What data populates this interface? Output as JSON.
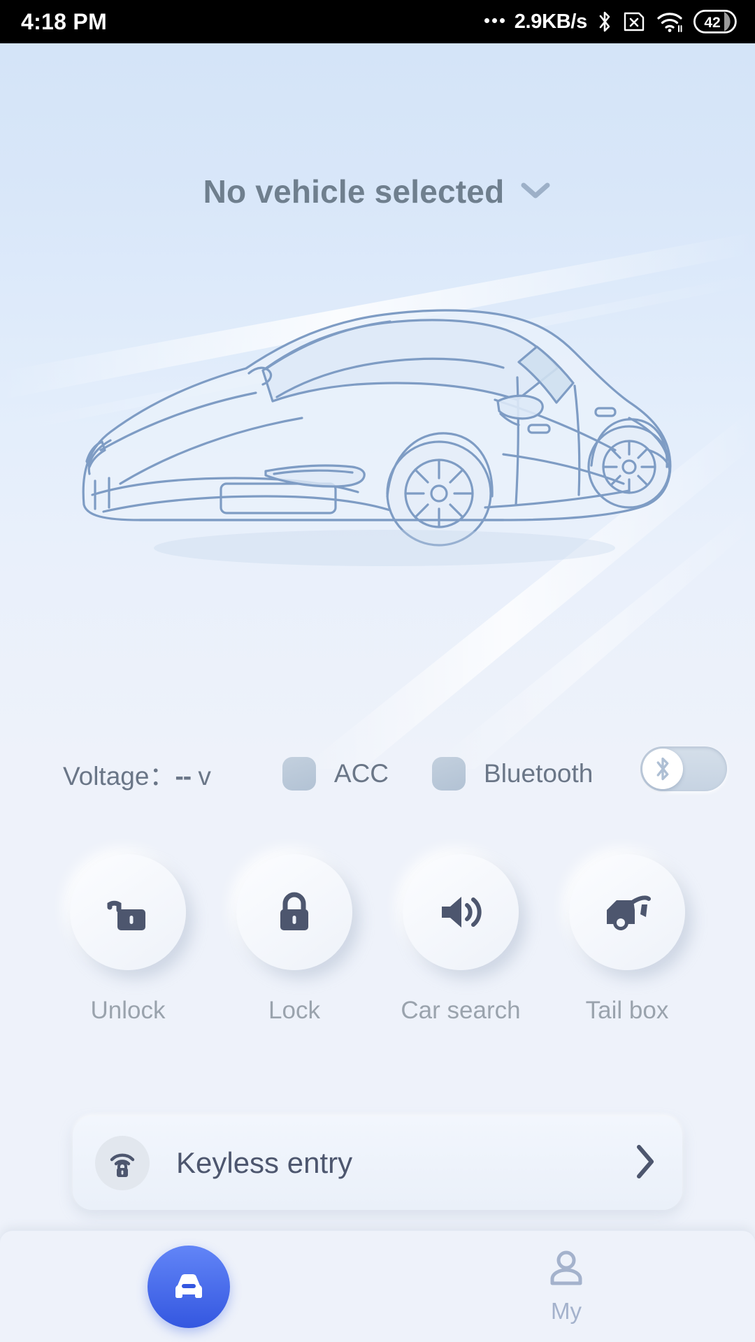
{
  "status_bar": {
    "time": "4:18 PM",
    "data_rate": "2.9KB/s",
    "battery_level": "42",
    "icons": [
      "bluetooth-icon",
      "sim-disabled-icon",
      "wifi-icon",
      "battery-icon"
    ]
  },
  "header": {
    "title": "No vehicle selected",
    "dropdown_icon": "chevron-down-icon",
    "illustration": "car-line-art-illustration"
  },
  "vehicle_status": {
    "voltage_label": "Voltage：",
    "voltage_value": "--",
    "voltage_unit": "v",
    "acc_label": "ACC",
    "bluetooth_label": "Bluetooth",
    "bluetooth_toggle_state": "off",
    "bluetooth_toggle_icon": "bluetooth-icon"
  },
  "actions": [
    {
      "label": "Unlock",
      "icon": "unlock-icon"
    },
    {
      "label": "Lock",
      "icon": "lock-icon"
    },
    {
      "label": "Car search",
      "icon": "speaker-volume-icon"
    },
    {
      "label": "Tail box",
      "icon": "car-trunk-open-icon"
    }
  ],
  "keyless_entry": {
    "label": "Keyless entry",
    "icon": "keyless-signal-lock-icon",
    "chevron_icon": "chevron-right-icon"
  },
  "bottom_nav": {
    "items": [
      {
        "label": "",
        "icon": "car-front-icon",
        "active": true
      },
      {
        "label": "My",
        "icon": "person-icon",
        "active": false
      }
    ]
  },
  "colors": {
    "accent_blue": "#3457e0",
    "title_text": "#6f7f8e",
    "body_text": "#6a7687",
    "icon_dark": "#4d566e",
    "label_muted": "#9aa3ad",
    "nav_inactive": "#a4b2cc",
    "hero_top": "#d4e4f8",
    "page_bg": "#eef2fa"
  }
}
